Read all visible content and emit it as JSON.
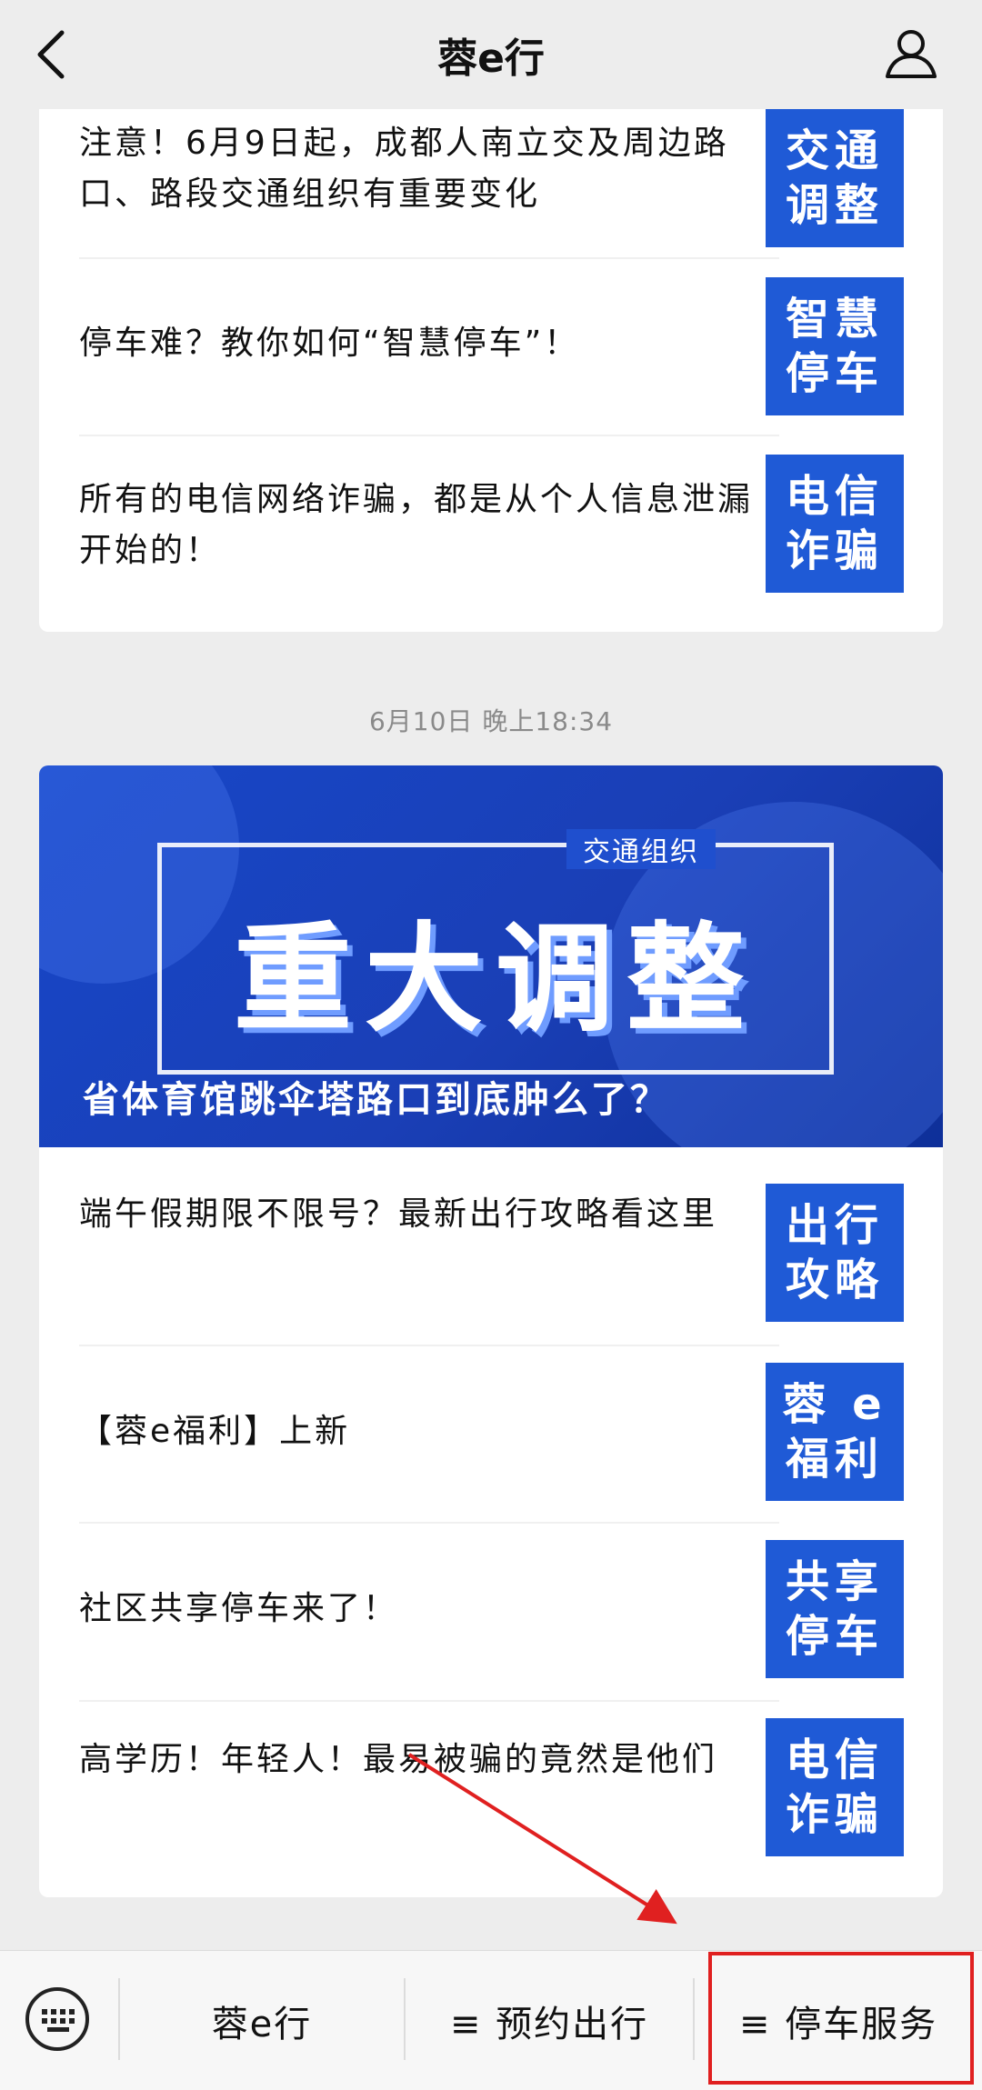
{
  "header": {
    "title": "蓉e行",
    "back_icon": "back-icon",
    "user_icon": "user-icon"
  },
  "card1": {
    "items": [
      {
        "text": "注意！6月9日起，成都人南立交及周边路口、路段交通组织有重要变化",
        "thumb": [
          "交通",
          "调整"
        ]
      },
      {
        "text": "停车难？教你如何“智慧停车”！",
        "thumb": [
          "智慧",
          "停车"
        ]
      },
      {
        "text": "所有的电信网络诈骗，都是从个人信息泄漏开始的！",
        "thumb": [
          "电信",
          "诈骗"
        ]
      }
    ]
  },
  "timestamp": "6月10日 晚上18:34",
  "card2": {
    "banner": {
      "label": "交通组织",
      "headline": "重大调整",
      "caption": "省体育馆跳伞塔路口到底肿么了？"
    },
    "items": [
      {
        "text": "端午假期限不限号？最新出行攻略看这里",
        "thumb": [
          "出行",
          "攻略"
        ]
      },
      {
        "text": "【蓉e福利】上新",
        "thumb": [
          "蓉 e",
          "福利"
        ]
      },
      {
        "text": "社区共享停车来了！",
        "thumb": [
          "共享",
          "停车"
        ]
      },
      {
        "text": "高学历！年轻人！最易被骗的竟然是他们",
        "thumb": [
          "电信",
          "诈骗"
        ]
      }
    ]
  },
  "bottom_menu": {
    "keyboard_icon": "keyboard-icon",
    "items": [
      "蓉e行",
      "≡ 预约出行",
      "≡ 停车服务"
    ]
  },
  "colors": {
    "thumb_blue": "#1f5ad6",
    "highlight_red": "#e02020",
    "background": "#ededed"
  }
}
